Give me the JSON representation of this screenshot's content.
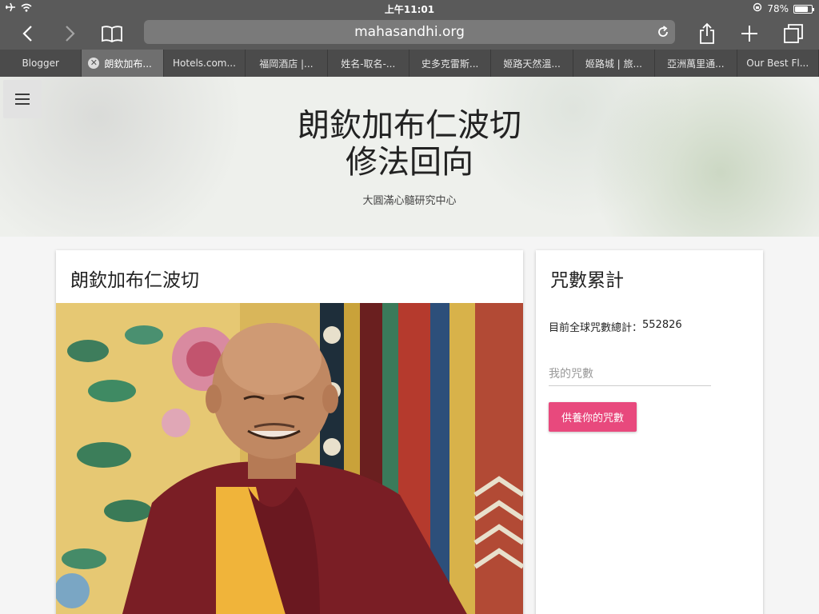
{
  "status_bar": {
    "time": "上午11:01",
    "battery_text": "78%",
    "battery_level": 0.78,
    "icons": [
      "airplane-icon",
      "wifi-icon",
      "rotation-lock-icon",
      "battery-icon"
    ]
  },
  "toolbar": {
    "url": "mahasandhi.org",
    "icons": [
      "back-icon",
      "forward-icon",
      "bookmarks-icon",
      "reload-icon",
      "share-icon",
      "new-tab-icon",
      "tabs-overview-icon"
    ]
  },
  "tabs": [
    {
      "label": "Blogger"
    },
    {
      "label": "朗欽加布...",
      "active": true
    },
    {
      "label": "Hotels.com..."
    },
    {
      "label": "福岡酒店 |..."
    },
    {
      "label": "姓名-取名-..."
    },
    {
      "label": "史多克雷斯..."
    },
    {
      "label": "姬路天然溫..."
    },
    {
      "label": "姬路城 | 旅..."
    },
    {
      "label": "亞洲萬里通..."
    },
    {
      "label": "Our Best Fl..."
    }
  ],
  "hero": {
    "title_line1": "朗欽加布仁波切",
    "title_line2": "修法回向",
    "subtitle": "大圓滿心髓研究中心",
    "colors": {
      "text": "#222222",
      "background": "#eef0ec"
    }
  },
  "main_card": {
    "title": "朗欽加布仁波切",
    "photo_alt": "photo-of-rinpoche"
  },
  "side_card": {
    "title": "咒數累計",
    "total_label": "目前全球咒數總計：",
    "total_value": "552826",
    "input_placeholder": "我的咒數",
    "button_label": "供養你的咒數",
    "accent_color": "#e8497d"
  }
}
